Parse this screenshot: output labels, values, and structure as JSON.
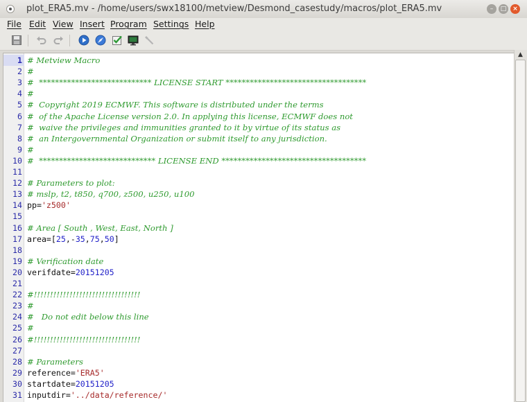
{
  "window": {
    "title": "plot_ERA5.mv - /home/users/swx18100/metview/Desmond_casestudy/macros/plot_ERA5.mv",
    "minimize_glyph": "–",
    "maximize_glyph": "□",
    "close_glyph": "×"
  },
  "menubar": [
    "File",
    "Edit",
    "View",
    "Insert",
    "Program",
    "Settings",
    "Help"
  ],
  "toolbar": {
    "icons": [
      "save-icon",
      "undo-icon",
      "redo-icon",
      "run-icon",
      "compass-icon",
      "check-icon",
      "monitor-icon",
      "tool-icon"
    ]
  },
  "editor": {
    "current_line": 1,
    "lines": [
      {
        "n": "1",
        "tokens": [
          {
            "t": "# Metview Macro",
            "c": "comment"
          }
        ]
      },
      {
        "n": "2",
        "tokens": [
          {
            "t": "#",
            "c": "comment"
          }
        ]
      },
      {
        "n": "3",
        "tokens": [
          {
            "t": "#  **************************** LICENSE START ***********************************",
            "c": "comment"
          }
        ]
      },
      {
        "n": "4",
        "tokens": [
          {
            "t": "#",
            "c": "comment"
          }
        ]
      },
      {
        "n": "5",
        "tokens": [
          {
            "t": "#  Copyright 2019 ECMWF. This software is distributed under the terms",
            "c": "comment"
          }
        ]
      },
      {
        "n": "6",
        "tokens": [
          {
            "t": "#  of the Apache License version 2.0. In applying this license, ECMWF does not",
            "c": "comment"
          }
        ]
      },
      {
        "n": "7",
        "tokens": [
          {
            "t": "#  waive the privileges and immunities granted to it by virtue of its status as",
            "c": "comment"
          }
        ]
      },
      {
        "n": "8",
        "tokens": [
          {
            "t": "#  an Intergovernmental Organization or submit itself to any jurisdiction.",
            "c": "comment"
          }
        ]
      },
      {
        "n": "9",
        "tokens": [
          {
            "t": "#",
            "c": "comment"
          }
        ]
      },
      {
        "n": "10",
        "tokens": [
          {
            "t": "#  ***************************** LICENSE END ************************************",
            "c": "comment"
          }
        ]
      },
      {
        "n": "11",
        "tokens": []
      },
      {
        "n": "12",
        "tokens": [
          {
            "t": "# Parameters to plot:",
            "c": "comment"
          }
        ]
      },
      {
        "n": "13",
        "tokens": [
          {
            "t": "# mslp, t2, t850, q700, z500, u250, u100",
            "c": "comment"
          }
        ]
      },
      {
        "n": "14",
        "tokens": [
          {
            "t": "pp=",
            "c": "plain"
          },
          {
            "t": "'z500'",
            "c": "string"
          }
        ]
      },
      {
        "n": "15",
        "tokens": []
      },
      {
        "n": "16",
        "tokens": [
          {
            "t": "# Area [ South , West, East, North ]",
            "c": "comment"
          }
        ]
      },
      {
        "n": "17",
        "tokens": [
          {
            "t": "area=[",
            "c": "plain"
          },
          {
            "t": "25",
            "c": "num"
          },
          {
            "t": ",-",
            "c": "plain"
          },
          {
            "t": "35",
            "c": "num"
          },
          {
            "t": ",",
            "c": "plain"
          },
          {
            "t": "75",
            "c": "num"
          },
          {
            "t": ",",
            "c": "plain"
          },
          {
            "t": "50",
            "c": "num"
          },
          {
            "t": "]",
            "c": "plain"
          }
        ]
      },
      {
        "n": "18",
        "tokens": []
      },
      {
        "n": "19",
        "tokens": [
          {
            "t": "# Verification date",
            "c": "comment"
          }
        ]
      },
      {
        "n": "20",
        "tokens": [
          {
            "t": "verifdate=",
            "c": "plain"
          },
          {
            "t": "20151205",
            "c": "num"
          }
        ]
      },
      {
        "n": "21",
        "tokens": []
      },
      {
        "n": "22",
        "tokens": [
          {
            "t": "#!!!!!!!!!!!!!!!!!!!!!!!!!!!!!!!!!",
            "c": "comment"
          }
        ]
      },
      {
        "n": "23",
        "tokens": [
          {
            "t": "#",
            "c": "comment"
          }
        ]
      },
      {
        "n": "24",
        "tokens": [
          {
            "t": "#   Do not edit below this line",
            "c": "comment"
          }
        ]
      },
      {
        "n": "25",
        "tokens": [
          {
            "t": "#",
            "c": "comment"
          }
        ]
      },
      {
        "n": "26",
        "tokens": [
          {
            "t": "#!!!!!!!!!!!!!!!!!!!!!!!!!!!!!!!!!",
            "c": "comment"
          }
        ]
      },
      {
        "n": "27",
        "tokens": []
      },
      {
        "n": "28",
        "tokens": [
          {
            "t": "# Parameters",
            "c": "comment"
          }
        ]
      },
      {
        "n": "29",
        "tokens": [
          {
            "t": "reference=",
            "c": "plain"
          },
          {
            "t": "'ERA5'",
            "c": "string"
          }
        ]
      },
      {
        "n": "30",
        "tokens": [
          {
            "t": "startdate=",
            "c": "plain"
          },
          {
            "t": "20151205",
            "c": "num"
          }
        ]
      },
      {
        "n": "31",
        "tokens": [
          {
            "t": "inputdir=",
            "c": "plain"
          },
          {
            "t": "'../data/reference/'",
            "c": "string"
          }
        ]
      }
    ]
  }
}
